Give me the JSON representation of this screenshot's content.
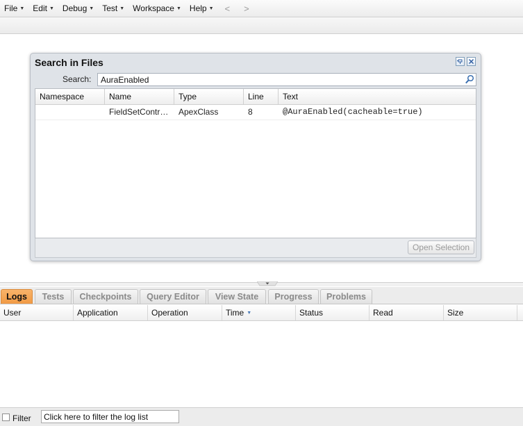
{
  "menu": {
    "items": [
      "File",
      "Edit",
      "Debug",
      "Test",
      "Workspace",
      "Help"
    ],
    "back": "<",
    "forward": ">"
  },
  "search_dialog": {
    "title": "Search in Files",
    "search_label": "Search:",
    "search_value": "AuraEnabled",
    "columns": [
      "Namespace",
      "Name",
      "Type",
      "Line",
      "Text"
    ],
    "rows": [
      {
        "namespace": "",
        "name": "FieldSetContro...",
        "type": "ApexClass",
        "line": "8",
        "text": "@AuraEnabled(cacheable=true)"
      }
    ],
    "open_selection_label": "Open Selection"
  },
  "bottom_panel": {
    "tabs": [
      "Logs",
      "Tests",
      "Checkpoints",
      "Query Editor",
      "View State",
      "Progress",
      "Problems"
    ],
    "active_tab": "Logs",
    "log_columns": [
      "User",
      "Application",
      "Operation",
      "Time",
      "Status",
      "Read",
      "Size"
    ],
    "sorted_column": "Time",
    "filter_label": "Filter",
    "filter_placeholder": "Click here to filter the log list"
  },
  "colors": {
    "active_tab": "#f4a653",
    "dialog_bg": "#dfe3e8",
    "link_blue": "#3d6fb5"
  }
}
